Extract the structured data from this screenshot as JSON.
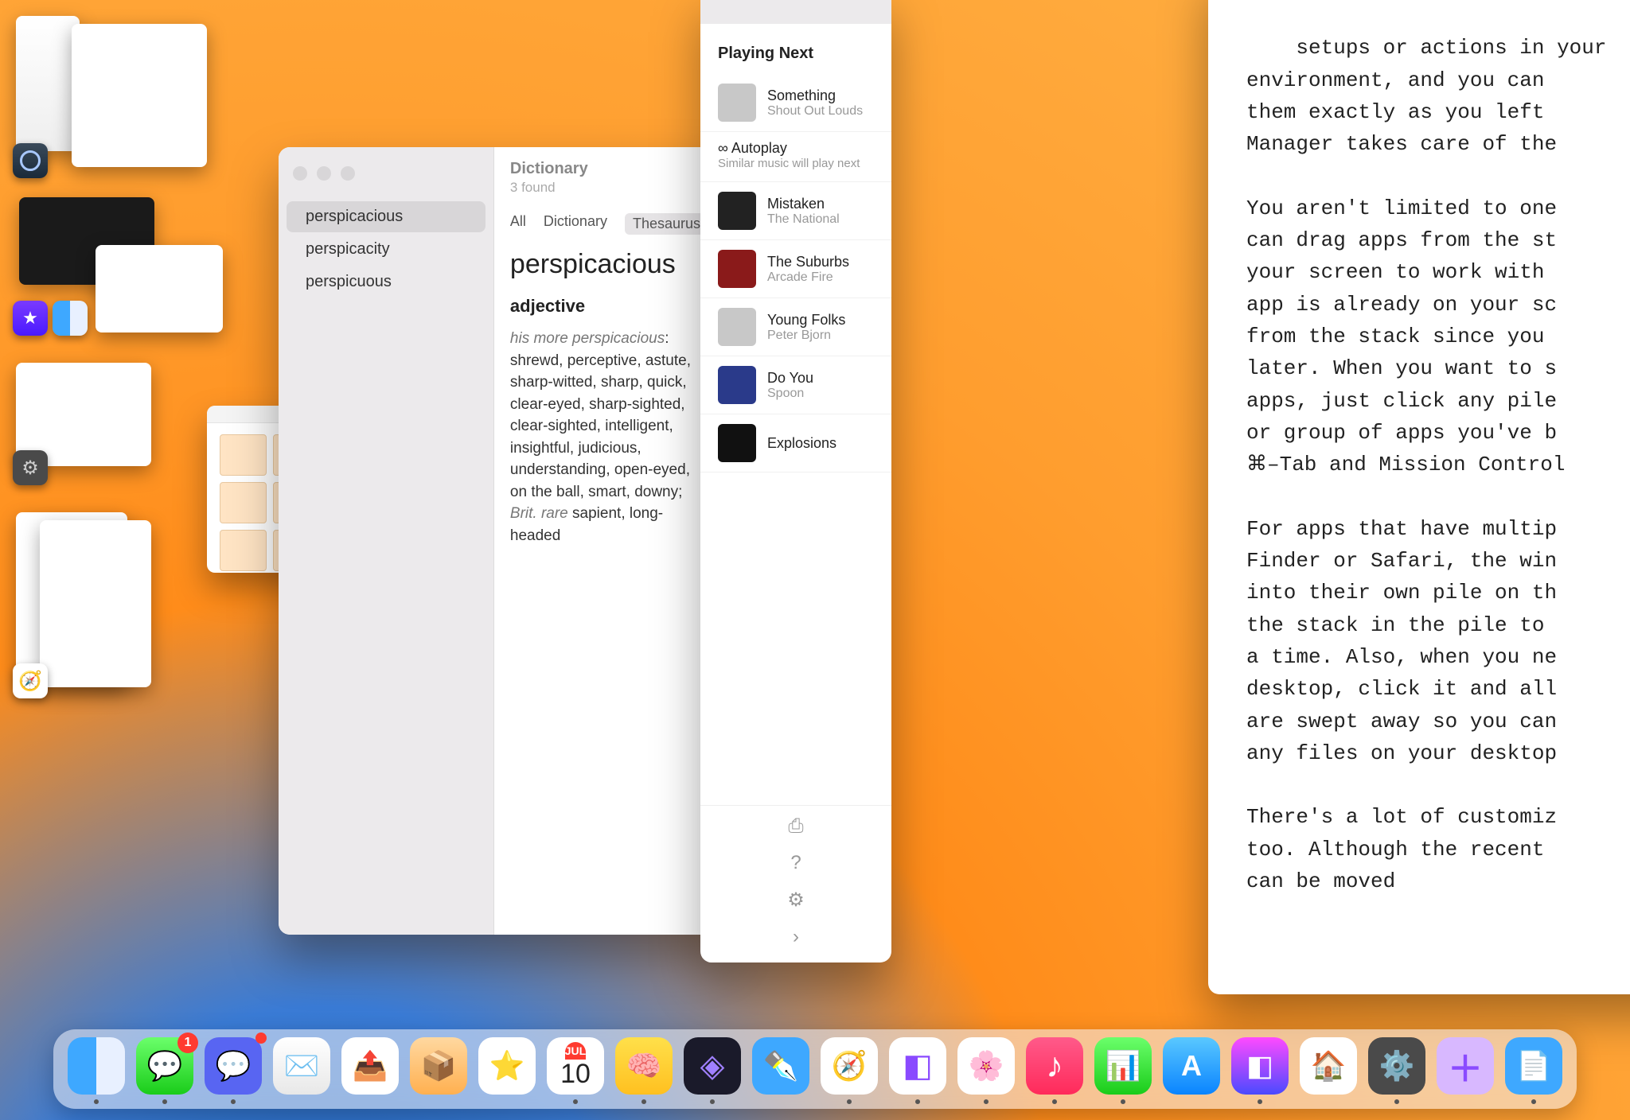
{
  "stage_groups": [
    {
      "icon": "quicktime"
    },
    {
      "icon": "imovie_finder"
    },
    {
      "icon": "system_settings"
    },
    {
      "icon": "safari"
    }
  ],
  "dictionary": {
    "header_title": "Dictionary",
    "header_sub": "3 found",
    "sidebar": [
      "perspicacious",
      "perspicacity",
      "perspicuous"
    ],
    "tabs": [
      "All",
      "Dictionary",
      "Thesaurus"
    ],
    "selected_tab": 2,
    "word": "perspicacious",
    "pos": "adjective",
    "example_prefix": "his more perspicacious",
    "definition_rest": "shrewd, perceptive, astute, sharp-witted, sharp, quick, clear-eyed, sharp-sighted, clear-sighted, intelligent, insightful, judicious, understanding, open-eyed, on the ball, smart, downy;",
    "def_tail_italic": "Brit. rare",
    "def_tail": " sapient, long-headed"
  },
  "music": {
    "header": "Playing Next",
    "autoplay_title": "∞ Autoplay",
    "autoplay_sub": "Similar music will play next",
    "tracks": [
      {
        "title": "Something",
        "artist": "Shout Out Louds",
        "art": "gr"
      },
      {
        "title": "Mistaken",
        "artist": "The National",
        "art": "dk"
      },
      {
        "title": "The Suburbs",
        "artist": "Arcade Fire",
        "art": "rd"
      },
      {
        "title": "Young Folks",
        "artist": "Peter Bjorn",
        "art": "gr"
      },
      {
        "title": "Do You",
        "artist": "Spoon",
        "art": "bl"
      },
      {
        "title": "Explosions",
        "artist": "",
        "art": "bk"
      }
    ]
  },
  "doc": {
    "text": "setups or actions in your\nenvironment, and you can\nthem exactly as you left\nManager takes care of the\n\nYou aren't limited to one\ncan drag apps from the st\nyour screen to work with\napp is already on your sc\nfrom the stack since you\nlater. When you want to s\napps, just click any pile\nor group of apps you've b\n⌘–Tab and Mission Control\n\nFor apps that have multip\nFinder or Safari, the win\ninto their own pile on th\nthe stack in the pile to\na time. Also, when you ne\ndesktop, click it and all\nare swept away so you can\nany files on your desktop\n\nThere's a lot of customiz\ntoo. Although the recent\ncan be moved"
  },
  "dock": {
    "cal_month": "JUL",
    "cal_day": "10",
    "items": [
      {
        "name": "finder",
        "cls": "di-finder",
        "running": true,
        "badge": null
      },
      {
        "name": "messages",
        "cls": "di-msg",
        "running": true,
        "badge": "1"
      },
      {
        "name": "discord",
        "cls": "di-disc",
        "running": true,
        "badge": " "
      },
      {
        "name": "mail",
        "cls": "di-mail",
        "running": false,
        "badge": null
      },
      {
        "name": "send",
        "cls": "di-send",
        "running": false,
        "badge": null
      },
      {
        "name": "package",
        "cls": "di-box",
        "running": false,
        "badge": null
      },
      {
        "name": "star-app",
        "cls": "di-star",
        "running": false,
        "badge": null
      },
      {
        "name": "calendar",
        "cls": "di-cal",
        "running": true,
        "badge": null
      },
      {
        "name": "brain-app",
        "cls": "di-brain",
        "running": true,
        "badge": null
      },
      {
        "name": "obsidian",
        "cls": "di-obs",
        "running": true,
        "badge": null
      },
      {
        "name": "feather-app",
        "cls": "di-feat",
        "running": false,
        "badge": null
      },
      {
        "name": "safari",
        "cls": "di-safari",
        "running": true,
        "badge": null
      },
      {
        "name": "craft",
        "cls": "di-craft",
        "running": true,
        "badge": null
      },
      {
        "name": "photos",
        "cls": "di-photos",
        "running": true,
        "badge": null
      },
      {
        "name": "music",
        "cls": "di-music",
        "running": true,
        "badge": null
      },
      {
        "name": "numbers",
        "cls": "di-num",
        "running": true,
        "badge": null
      },
      {
        "name": "app-store",
        "cls": "di-apps",
        "running": false,
        "badge": null
      },
      {
        "name": "shortcuts",
        "cls": "di-sc",
        "running": true,
        "badge": null
      },
      {
        "name": "home",
        "cls": "di-home",
        "running": false,
        "badge": null
      },
      {
        "name": "system-settings",
        "cls": "di-set",
        "running": true,
        "badge": null
      },
      {
        "name": "freeform",
        "cls": "di-fh",
        "running": false,
        "badge": null
      },
      {
        "name": "pages",
        "cls": "di-pages",
        "running": true,
        "badge": null
      }
    ]
  }
}
